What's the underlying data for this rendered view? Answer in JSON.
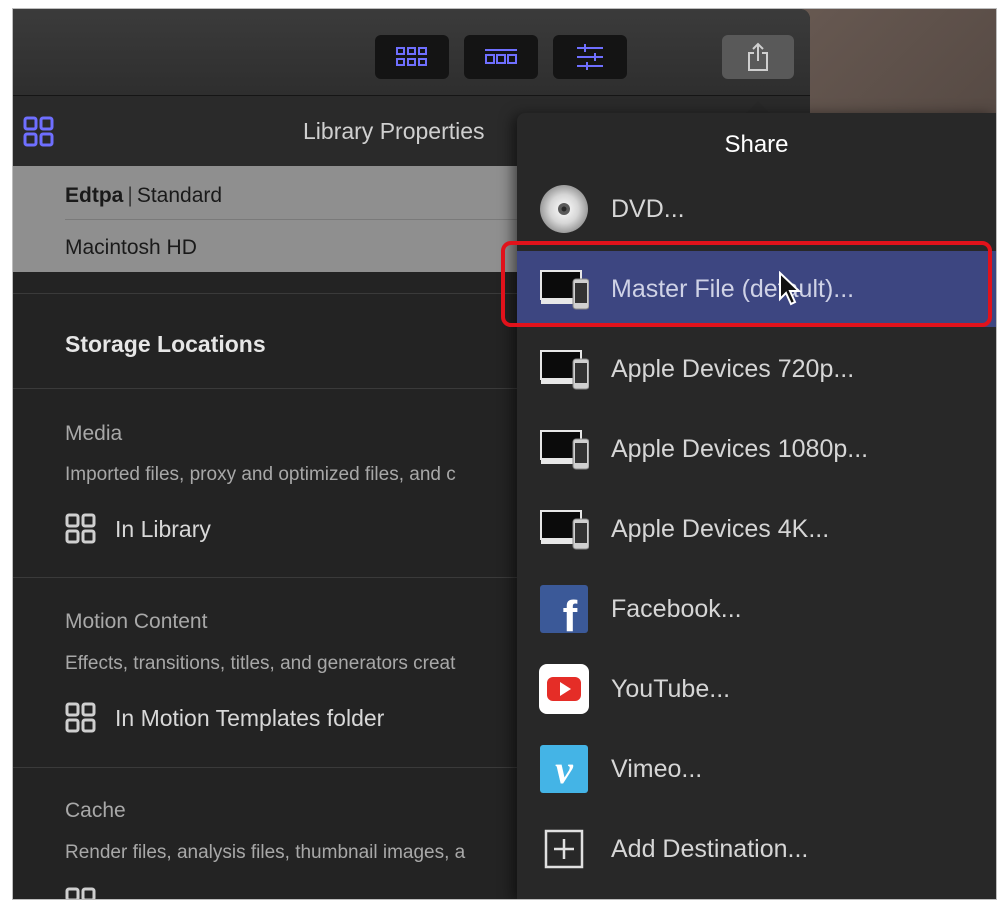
{
  "properties": {
    "title": "Library Properties",
    "library_name": "Edtpa",
    "separator": "|",
    "library_type": "Standard",
    "volume": "Macintosh HD"
  },
  "storage": {
    "title": "Storage Locations",
    "sections": [
      {
        "title": "Media",
        "desc": "Imported files, proxy and optimized files, and c",
        "location": "In Library"
      },
      {
        "title": "Motion Content",
        "desc": "Effects, transitions, titles, and generators creat",
        "location": "In Motion Templates folder"
      },
      {
        "title": "Cache",
        "desc": "Render files, analysis files, thumbnail images, a",
        "location": ""
      }
    ]
  },
  "share": {
    "title": "Share",
    "items": [
      {
        "label": "DVD...",
        "icon": "dvd-disc-icon"
      },
      {
        "label": "Master File (default)...",
        "icon": "computer-devices-icon",
        "highlighted": true
      },
      {
        "label": "Apple Devices 720p...",
        "icon": "computer-devices-icon"
      },
      {
        "label": "Apple Devices 1080p...",
        "icon": "computer-devices-icon"
      },
      {
        "label": "Apple Devices 4K...",
        "icon": "computer-devices-icon"
      },
      {
        "label": "Facebook...",
        "icon": "facebook-icon"
      },
      {
        "label": "YouTube...",
        "icon": "youtube-icon"
      },
      {
        "label": "Vimeo...",
        "icon": "vimeo-icon"
      },
      {
        "label": "Add Destination...",
        "icon": "add-destination-icon"
      }
    ]
  },
  "colors": {
    "highlight": "#3d4681",
    "annotation_box": "#e1121b",
    "accent_icon": "#6b6bff"
  }
}
